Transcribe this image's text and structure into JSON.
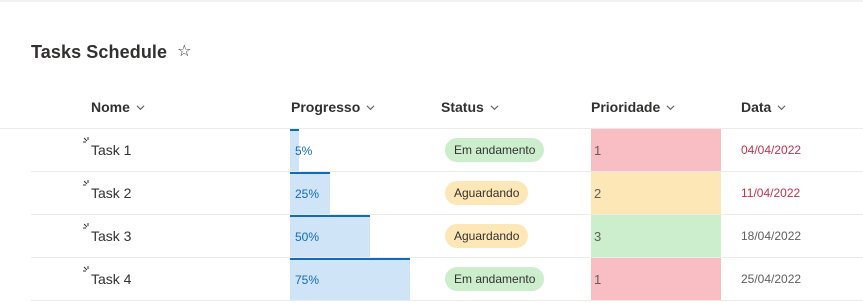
{
  "title": "Tasks Schedule",
  "icons": {
    "favorite": "star-outline-icon",
    "sort": "chevron-down-icon",
    "new_item": "new-item-sparkle-icon"
  },
  "columns": {
    "name": "Nome",
    "progress": "Progresso",
    "status": "Status",
    "priority": "Prioridade",
    "date": "Data"
  },
  "colors": {
    "progress_fill": "#cfe4f6",
    "progress_bar": "#0f6cbd",
    "status_in_progress": "#cdeecd",
    "status_waiting": "#fde7b6",
    "priority_1": "#f9bec4",
    "priority_2": "#fde7b6",
    "priority_3": "#cdeecd",
    "date_overdue": "#c4314b",
    "date_normal": "#605e5c"
  },
  "rows": [
    {
      "name": "Task 1",
      "progress": "5%",
      "progress_value": 0.05,
      "status": "Em andamento",
      "status_kind": "in_progress",
      "priority": "1",
      "date": "04/04/2022",
      "date_overdue": true
    },
    {
      "name": "Task 2",
      "progress": "25%",
      "progress_value": 0.25,
      "status": "Aguardando",
      "status_kind": "waiting",
      "priority": "2",
      "date": "11/04/2022",
      "date_overdue": true
    },
    {
      "name": "Task 3",
      "progress": "50%",
      "progress_value": 0.5,
      "status": "Aguardando",
      "status_kind": "waiting",
      "priority": "3",
      "date": "18/04/2022",
      "date_overdue": false
    },
    {
      "name": "Task 4",
      "progress": "75%",
      "progress_value": 0.75,
      "status": "Em andamento",
      "status_kind": "in_progress",
      "priority": "1",
      "date": "25/04/2022",
      "date_overdue": false
    }
  ]
}
